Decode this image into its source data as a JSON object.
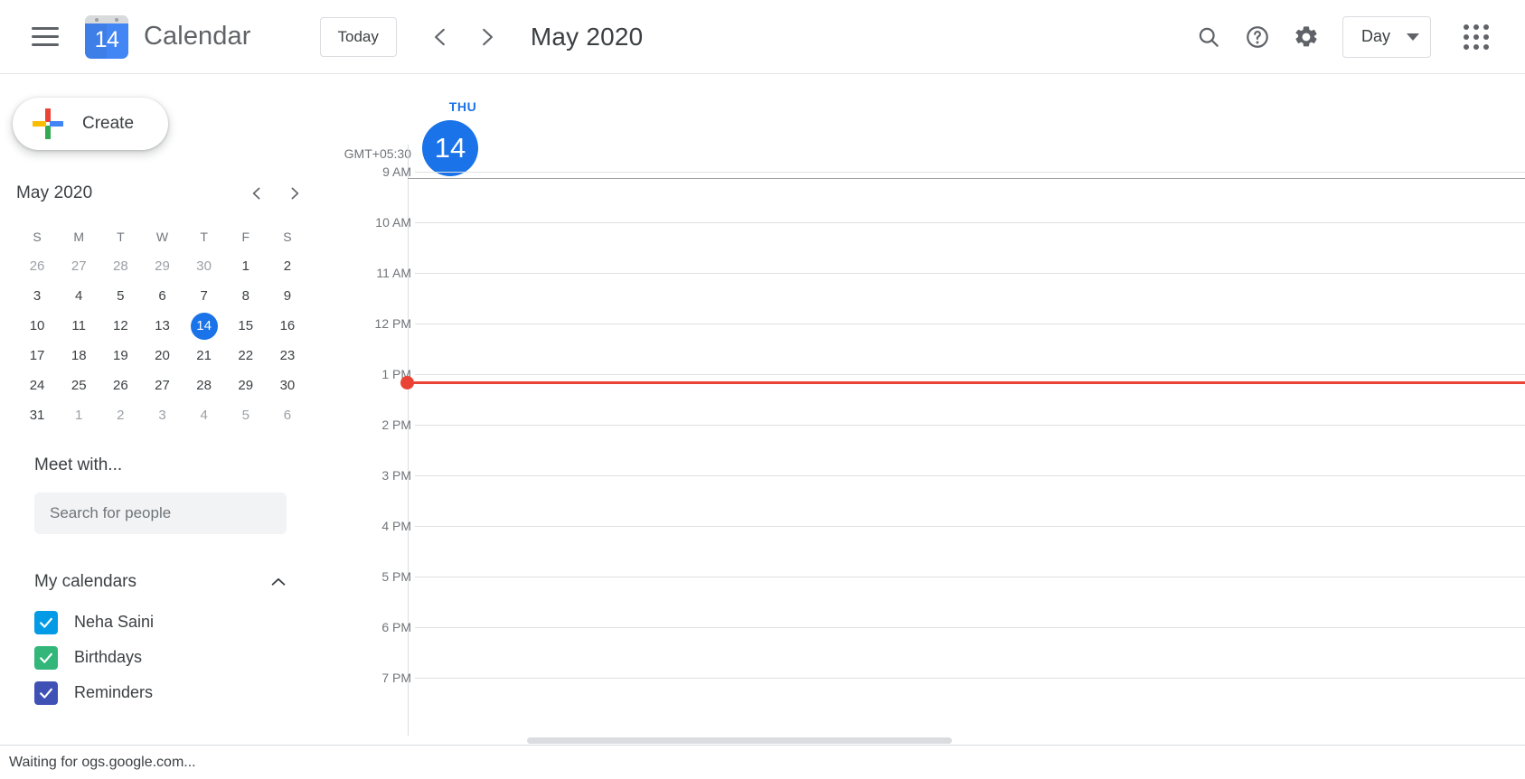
{
  "header": {
    "menu_icon": "hamburger-icon",
    "logo_day_number": "14",
    "app_title": "Calendar",
    "today_label": "Today",
    "prev_icon": "chevron-left-icon",
    "next_icon": "chevron-right-icon",
    "date_title": "May 2020",
    "search_icon": "search-icon",
    "help_icon": "help-icon",
    "settings_icon": "gear-icon",
    "view_label": "Day",
    "view_caret": "chevron-down-icon",
    "apps_icon": "apps-grid-icon"
  },
  "sidebar": {
    "create_label": "Create",
    "create_icon": "google-plus-icon",
    "mini_calendar": {
      "title": "May 2020",
      "prev_icon": "chevron-left-icon",
      "next_icon": "chevron-right-icon",
      "day_initials": [
        "S",
        "M",
        "T",
        "W",
        "T",
        "F",
        "S"
      ],
      "weeks": [
        [
          {
            "d": "26",
            "muted": true
          },
          {
            "d": "27",
            "muted": true
          },
          {
            "d": "28",
            "muted": true
          },
          {
            "d": "29",
            "muted": true
          },
          {
            "d": "30",
            "muted": true
          },
          {
            "d": "1",
            "muted": false
          },
          {
            "d": "2",
            "muted": false
          }
        ],
        [
          {
            "d": "3",
            "muted": false
          },
          {
            "d": "4",
            "muted": false
          },
          {
            "d": "5",
            "muted": false
          },
          {
            "d": "6",
            "muted": false
          },
          {
            "d": "7",
            "muted": false
          },
          {
            "d": "8",
            "muted": false
          },
          {
            "d": "9",
            "muted": false
          }
        ],
        [
          {
            "d": "10",
            "muted": false
          },
          {
            "d": "11",
            "muted": false
          },
          {
            "d": "12",
            "muted": false
          },
          {
            "d": "13",
            "muted": false
          },
          {
            "d": "14",
            "muted": false,
            "today": true
          },
          {
            "d": "15",
            "muted": false
          },
          {
            "d": "16",
            "muted": false
          }
        ],
        [
          {
            "d": "17",
            "muted": false
          },
          {
            "d": "18",
            "muted": false
          },
          {
            "d": "19",
            "muted": false
          },
          {
            "d": "20",
            "muted": false
          },
          {
            "d": "21",
            "muted": false
          },
          {
            "d": "22",
            "muted": false
          },
          {
            "d": "23",
            "muted": false
          }
        ],
        [
          {
            "d": "24",
            "muted": false
          },
          {
            "d": "25",
            "muted": false
          },
          {
            "d": "26",
            "muted": false
          },
          {
            "d": "27",
            "muted": false
          },
          {
            "d": "28",
            "muted": false
          },
          {
            "d": "29",
            "muted": false
          },
          {
            "d": "30",
            "muted": false
          }
        ],
        [
          {
            "d": "31",
            "muted": false
          },
          {
            "d": "1",
            "muted": true
          },
          {
            "d": "2",
            "muted": true
          },
          {
            "d": "3",
            "muted": true
          },
          {
            "d": "4",
            "muted": true
          },
          {
            "d": "5",
            "muted": true
          },
          {
            "d": "6",
            "muted": true
          }
        ]
      ]
    },
    "meet_with_title": "Meet with...",
    "people_search_placeholder": "Search for people",
    "people_search_value": "",
    "my_calendars_title": "My calendars",
    "my_calendars_collapse_icon": "chevron-up-icon",
    "calendars": [
      {
        "name": "Neha Saini",
        "color": "#039BE5",
        "checked": true
      },
      {
        "name": "Birthdays",
        "color": "#33B679",
        "checked": true
      },
      {
        "name": "Reminders",
        "color": "#3F51B5",
        "checked": true
      }
    ]
  },
  "main": {
    "timezone": "GMT+05:30",
    "day_of_week": "THU",
    "day_number": "14",
    "hours": [
      "9 AM",
      "10 AM",
      "11 AM",
      "12 PM",
      "1 PM",
      "2 PM",
      "3 PM",
      "4 PM",
      "5 PM",
      "6 PM",
      "7 PM"
    ],
    "current_time_color": "#EA4335"
  },
  "statusbar": {
    "text": "Waiting for ogs.google.com..."
  }
}
